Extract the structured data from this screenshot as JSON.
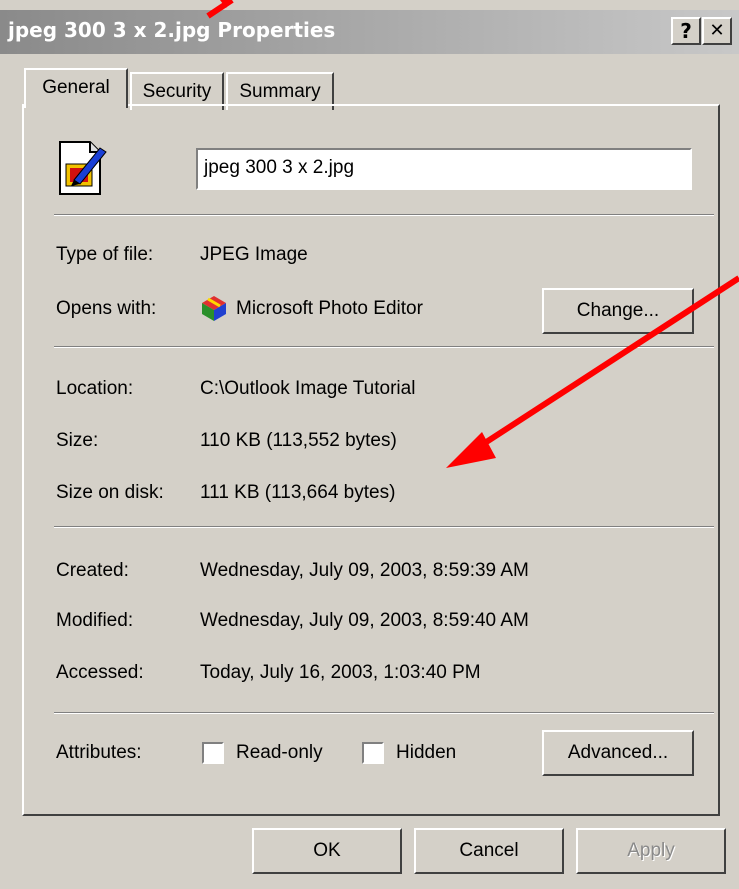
{
  "window": {
    "title": "jpeg 300 3 x 2.jpg Properties",
    "help_label": "?",
    "close_label": "✕"
  },
  "tabs": [
    {
      "label": "General",
      "active": true
    },
    {
      "label": "Security",
      "active": false
    },
    {
      "label": "Summary",
      "active": false
    }
  ],
  "file": {
    "name_value": "jpeg 300 3 x 2.jpg",
    "icon": "jpeg-image-file-icon"
  },
  "info": {
    "type_label": "Type of file:",
    "type_value": "JPEG Image",
    "opens_label": "Opens with:",
    "opens_value": "Microsoft Photo Editor",
    "opens_icon": "photo-editor-icon",
    "change_label": "Change...",
    "location_label": "Location:",
    "location_value": "C:\\Outlook Image Tutorial",
    "size_label": "Size:",
    "size_value": "110 KB (113,552 bytes)",
    "disk_label": "Size on disk:",
    "disk_value": "111 KB (113,664 bytes)",
    "created_label": "Created:",
    "created_value": "Wednesday, July 09, 2003, 8:59:39 AM",
    "modified_label": "Modified:",
    "modified_value": "Wednesday, July 09, 2003, 8:59:40 AM",
    "accessed_label": "Accessed:",
    "accessed_value": "Today, July 16, 2003, 1:03:40 PM"
  },
  "attributes": {
    "label": "Attributes:",
    "readonly_label": "Read-only",
    "readonly_checked": false,
    "hidden_label": "Hidden",
    "hidden_checked": false,
    "advanced_label": "Advanced..."
  },
  "buttons": {
    "ok": "OK",
    "cancel": "Cancel",
    "apply": "Apply"
  },
  "colors": {
    "face": "#d4d0c8",
    "title_gradient_start": "#8a8a8a",
    "title_gradient_end": "#c8c8c8",
    "annotation_arrow": "#ff0000",
    "disabled_text": "#8a8a8a"
  }
}
